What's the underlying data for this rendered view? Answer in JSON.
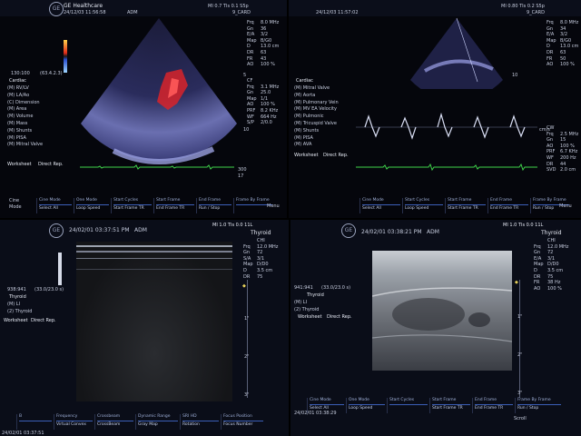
{
  "q1": {
    "brand": "GE Healthcare",
    "datetime": "24/12/03 11:56:58",
    "user": "ADM",
    "header_right": "MI 0.7  TIs 0.1  S5p",
    "probe_id": "9_CARD",
    "color_bar_label": "130:100",
    "color_bar_value": "(63.4.2.3)",
    "menu_title": "Cardiac",
    "menu": [
      "(M) RV/LV",
      "(M) LA/Ao",
      "(C) Dimension",
      "(M) Area",
      "(M) Volume",
      "(M) Mass",
      "(M) Shunts",
      "(M) PISA",
      "(M) Mitral Valve"
    ],
    "worksheet": "Worksheet",
    "direct_rep": "Direct Rep.",
    "params_b": [
      [
        "Frq",
        "8.0 MHz"
      ],
      [
        "Gn",
        "36"
      ],
      [
        "E/A",
        "3/2"
      ],
      [
        "Map",
        "B/G0"
      ],
      [
        "D",
        "13.0 cm"
      ],
      [
        "DR",
        "63"
      ],
      [
        "FR",
        "43"
      ],
      [
        "AO",
        "100 %"
      ]
    ],
    "params_cf": [
      [
        "CF",
        ""
      ],
      [
        "Frq",
        "3.1 MHz"
      ],
      [
        "Gn",
        "25.0"
      ],
      [
        "Map",
        "1/1"
      ],
      [
        "AO",
        "100 %"
      ],
      [
        "PRF",
        "8.2 KHz"
      ],
      [
        "WF",
        "664 Hz"
      ],
      [
        "S/P",
        "2/0.0"
      ]
    ],
    "depth_labels": [
      "5",
      "10"
    ],
    "scale_bottom": "300",
    "scale_bottom2": "17"
  },
  "q2": {
    "datetime": "24/12/03 11:57:02",
    "header_right": "MI 0.80  TIs 0.2  S5p",
    "probe_id": "9_CARD",
    "params_b": [
      [
        "Frq",
        "8.0 MHz"
      ],
      [
        "Gn",
        "34"
      ],
      [
        "E/A",
        "3/2"
      ],
      [
        "Map",
        "B/G0"
      ],
      [
        "D",
        "13.0 cm"
      ],
      [
        "DR",
        "63"
      ],
      [
        "FR",
        "50"
      ],
      [
        "AO",
        "100 %"
      ]
    ],
    "menu_title": "Cardiac",
    "menu": [
      "(M) Mitral Valve",
      "(M) Aorta",
      "(M) Pulmonary Vein",
      "(M) MV EA Velocity",
      "(M) Pulmonic",
      "(M) Tricuspid Valve",
      "(M) Shunts",
      "(M) PISA",
      "(M) AVA"
    ],
    "worksheet": "Worksheet",
    "direct_rep": "Direct Rep.",
    "params_cw": [
      [
        "CW",
        ""
      ],
      [
        "Frq",
        "2.5 MHz"
      ],
      [
        "Gn",
        "15"
      ],
      [
        "AO",
        "100 %"
      ],
      [
        "PRF",
        "6.7 KHz"
      ],
      [
        "WF",
        "200 Hz"
      ],
      [
        "DR",
        "44"
      ],
      [
        "SVD",
        "2.0 cm"
      ]
    ],
    "doppler_scale": "cm/s",
    "depth_label": "10"
  },
  "q1_bar": {
    "upper": [
      "Cine Mode",
      "One Mode",
      "Start Cycles",
      "Start Frame",
      "End Frame",
      "Frame By Frame"
    ],
    "lower": [
      "Select All",
      "Loop Speed",
      "Start Frame TR",
      "End Frame TR",
      "Run / Stop"
    ],
    "left_top": "Cine",
    "left_bottom": "Mode",
    "right": "Menu"
  },
  "q2_bar": {
    "upper": [
      "Cine Mode",
      "Start Cycles",
      "Start Frame",
      "End Frame",
      "Frame By Frame"
    ],
    "lower": [
      "Select All",
      "Loop Speed",
      "Start Frame TR",
      "End Frame TR",
      "Run / Stop"
    ],
    "right": "Menu"
  },
  "q3": {
    "datetime": "24/02/01 03:37:51 PM",
    "user": "ADM",
    "header_right": "MI 1.0  TIs 0.0  11L",
    "preset": "Thyroid",
    "params": [
      [
        "",
        "CHI"
      ],
      [
        "Frq",
        "12.0 MHz"
      ],
      [
        "Gn",
        "72"
      ],
      [
        "S/A",
        "3/1"
      ],
      [
        "Map",
        "D/D0"
      ],
      [
        "D",
        "3.5 cm"
      ],
      [
        "DR",
        "75"
      ],
      [
        "FR",
        "38 Hz"
      ],
      [
        "AO",
        "100 %"
      ]
    ],
    "cursor_line": "938:941",
    "cursor_value": "(33.0/23.0 s)",
    "menu_title": "Thyroid",
    "menu": [
      "(M) LI",
      "(2) Thyroid"
    ],
    "worksheet": "Worksheet",
    "direct_rep": "Direct Rep.",
    "depth_labels": [
      "1\"",
      "2\"",
      "3\""
    ],
    "bar_upper": [
      "B",
      "Frequency",
      "Crossbeam",
      "Dynamic Range",
      "SRI HD",
      "Focus Position"
    ],
    "bar_lower": [
      "Virtual Convex",
      "CrossBeam",
      "Gray Map",
      "Rotation",
      "Focus Number"
    ],
    "bottom_datetime": "24/02/01 03:37:51"
  },
  "q4": {
    "datetime": "24/02/01 03:38:21 PM",
    "user": "ADM",
    "header_right": "MI 1.0  TIs 0.0  11L",
    "preset": "Thyroid",
    "params": [
      [
        "",
        "CHI"
      ],
      [
        "Frq",
        "12.0 MHz"
      ],
      [
        "Gn",
        "72"
      ],
      [
        "E/A",
        "3/1"
      ],
      [
        "Map",
        "D/D0"
      ],
      [
        "D",
        "3.5 cm"
      ],
      [
        "DR",
        "75"
      ],
      [
        "FR",
        "38 Hz"
      ],
      [
        "AO",
        "100 %"
      ]
    ],
    "cursor_line": "941:941",
    "cursor_value": "(33.0/23.0 s)",
    "menu_title": "Thyroid",
    "menu": [
      "(M) LI",
      "(2) Thyroid"
    ],
    "worksheet": "Worksheet",
    "direct_rep": "Direct Rep.",
    "depth_labels": [
      "1\"",
      "2\"",
      "3\""
    ],
    "bar_upper": [
      "Cine Mode",
      "One Mode",
      "Start Cycles",
      "Start Frame",
      "End Frame",
      "Frame By Frame"
    ],
    "bar_lower": [
      "Select All",
      "Loop Speed",
      "Start Frame TR",
      "End Frame TR",
      "Run / Stop"
    ],
    "right": "Scroll",
    "bottom_datetime": "24/02/01 03:38:29"
  }
}
